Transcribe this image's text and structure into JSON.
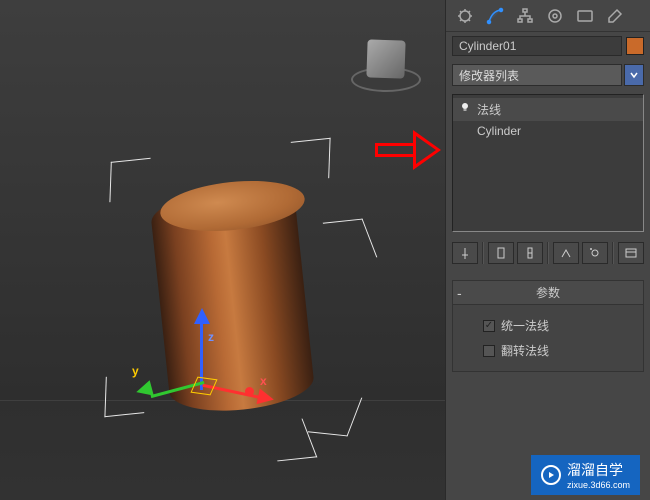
{
  "viewport": {
    "gizmo_labels": {
      "x": "x",
      "y": "y",
      "z": "z"
    }
  },
  "panel": {
    "object_name": "Cylinder01",
    "object_color": "#c96a2a",
    "modifier_dropdown": "修改器列表",
    "stack": [
      {
        "label": "法线",
        "has_bulb": true
      },
      {
        "label": "Cylinder",
        "has_bulb": false
      }
    ],
    "rollout_title": "参数",
    "checks": [
      {
        "label": "统一法线",
        "checked": true
      },
      {
        "label": "翻转法线",
        "checked": false
      }
    ]
  },
  "tool_icons": [
    "gear-icon",
    "curve-icon",
    "hierarchy-icon",
    "motion-icon",
    "display-icon",
    "utilities-icon"
  ],
  "mini_icons": [
    "pin-icon",
    "stack-icon",
    "stack2-icon",
    "show-icon",
    "subobj-icon",
    "config-icon"
  ],
  "watermark": {
    "brand": "溜溜自学",
    "url": "zixue.3d66.com"
  }
}
